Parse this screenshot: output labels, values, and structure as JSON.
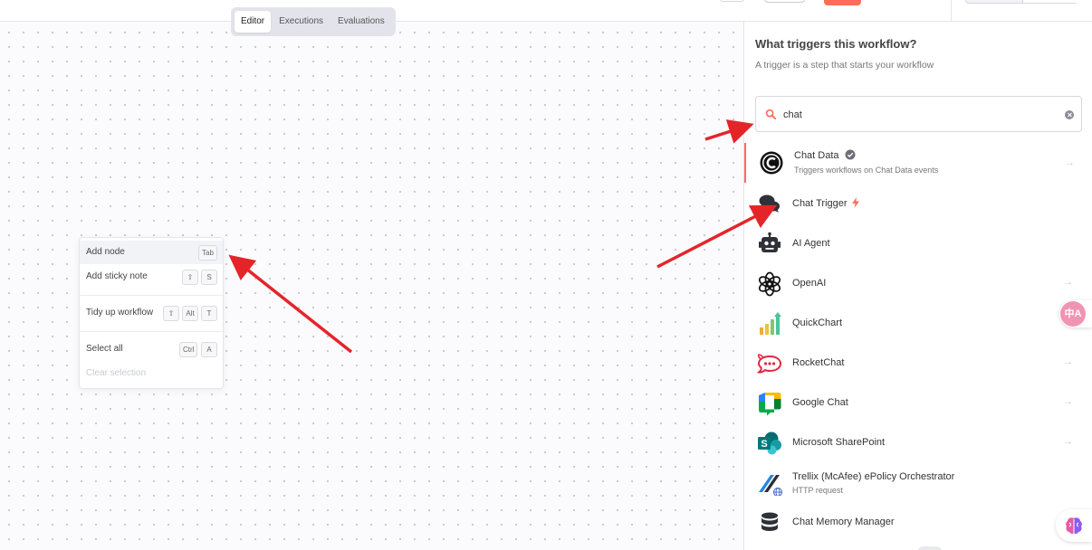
{
  "tabs": [
    {
      "label": "Editor",
      "active": true
    },
    {
      "label": "Executions",
      "active": false
    },
    {
      "label": "Evaluations",
      "active": false
    }
  ],
  "context_menu": {
    "items": [
      {
        "label": "Add node",
        "keys": [
          "Tab"
        ],
        "highlighted": true
      },
      {
        "label": "Add sticky note",
        "keys": [
          "⇧",
          "S"
        ]
      },
      {
        "label": "Tidy up workflow",
        "keys": [
          "⇧",
          "Alt",
          "T"
        ]
      },
      {
        "label": "Select all",
        "keys": [
          "Ctrl",
          "A"
        ]
      },
      {
        "label": "Clear selection",
        "keys": [],
        "disabled": true
      }
    ]
  },
  "panel": {
    "title": "What triggers this workflow?",
    "subtitle": "A trigger is a step that starts your workflow",
    "search": {
      "value": "chat",
      "icon": "search-icon"
    },
    "nodes": [
      {
        "name": "Chat Data",
        "description": "Triggers workflows on Chat Data events",
        "badge": "verified-icon",
        "icon": "chat-data-logo",
        "arrow": true,
        "selected": true
      },
      {
        "name": "Chat Trigger",
        "badge": "bolt-icon",
        "icon": "chat-bubbles-icon",
        "arrow": false
      },
      {
        "name": "AI Agent",
        "icon": "robot-icon",
        "arrow": false
      },
      {
        "name": "OpenAI",
        "icon": "openai-logo",
        "arrow": true
      },
      {
        "name": "QuickChart",
        "icon": "quickchart-logo",
        "arrow": false
      },
      {
        "name": "RocketChat",
        "icon": "rocketchat-logo",
        "arrow": true
      },
      {
        "name": "Google Chat",
        "icon": "google-chat-logo",
        "arrow": true
      },
      {
        "name": "Microsoft SharePoint",
        "icon": "sharepoint-logo",
        "arrow": true
      },
      {
        "name": "Trellix (McAfee) ePolicy Orchestrator",
        "description": "HTTP request",
        "icon": "trellix-logo",
        "arrow": false
      },
      {
        "name": "Chat Memory Manager",
        "icon": "database-icon",
        "arrow": false
      }
    ]
  },
  "widgets": {
    "translate_label": "中A"
  },
  "colors": {
    "accent": "#ff6d5a",
    "annotation_arrow": "#e5242a"
  }
}
